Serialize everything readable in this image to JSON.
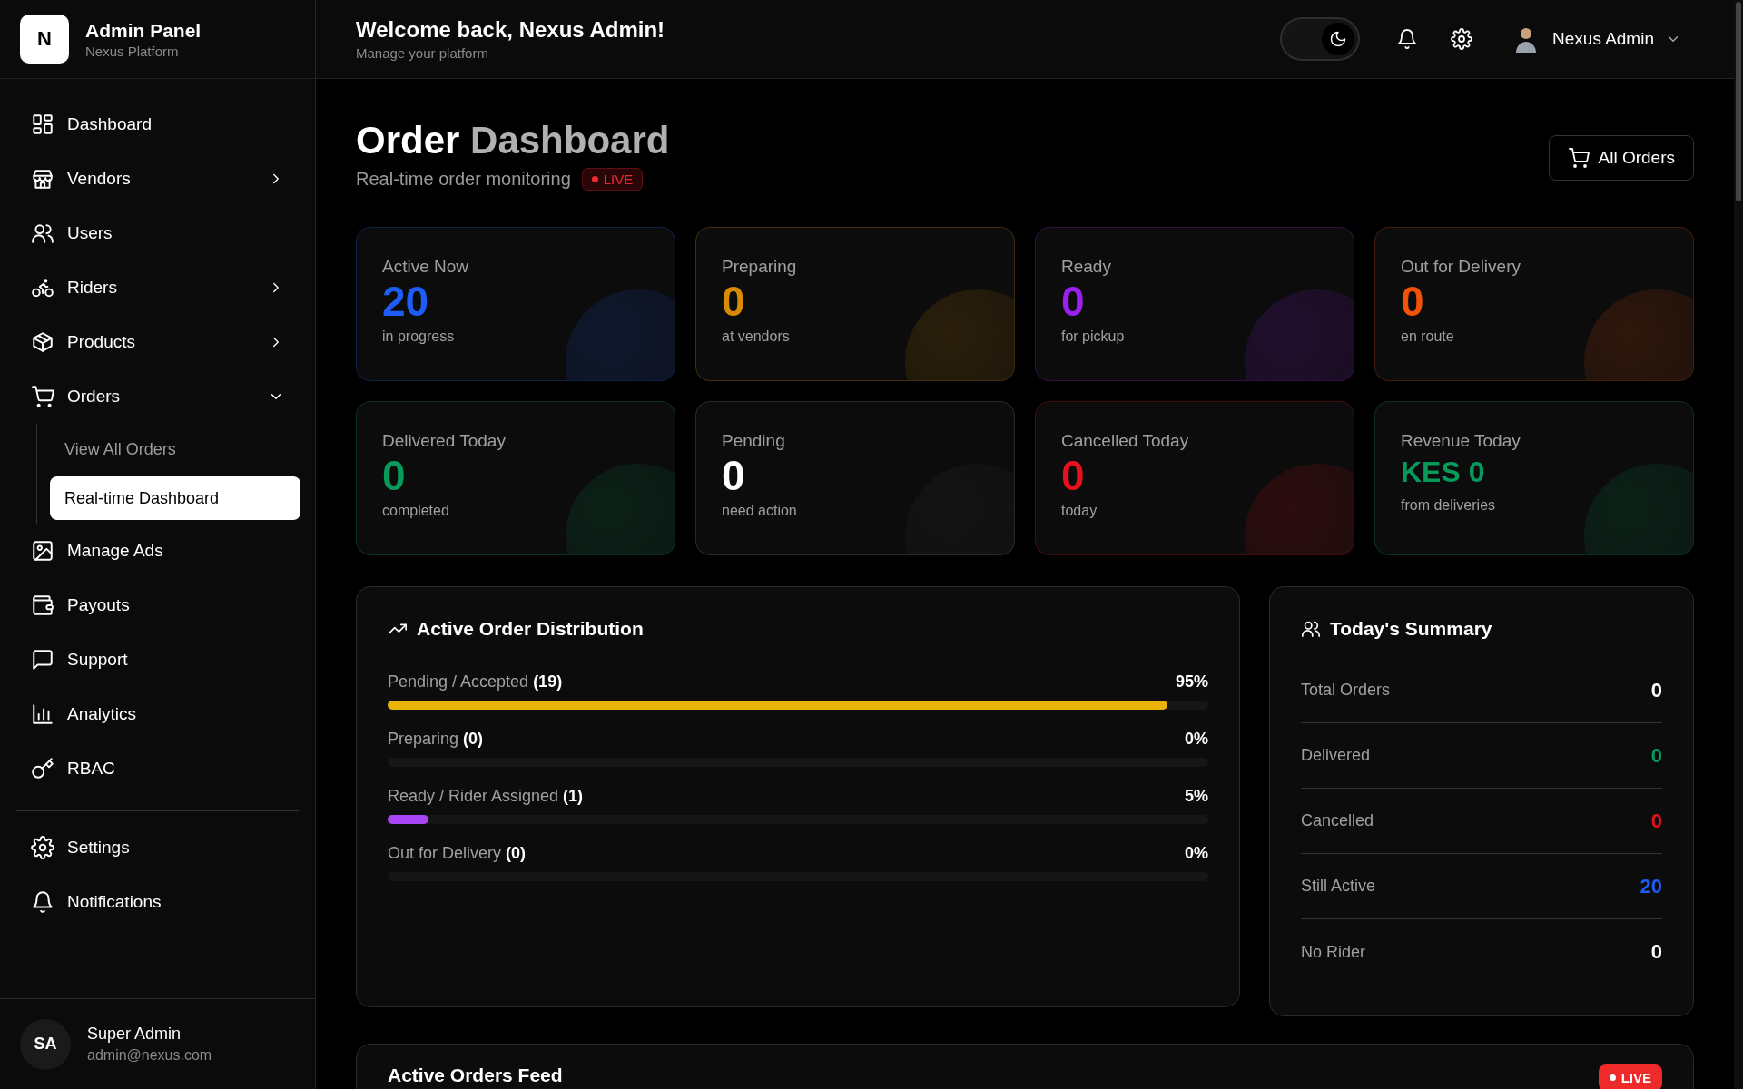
{
  "brand": {
    "logo_letter": "N",
    "title": "Admin Panel",
    "subtitle": "Nexus Platform"
  },
  "sidebar": {
    "items": [
      {
        "label": "Dashboard",
        "selected": false
      },
      {
        "label": "Vendors",
        "selected": false,
        "expanded": false
      },
      {
        "label": "Users",
        "selected": false
      },
      {
        "label": "Riders",
        "selected": false,
        "expanded": false
      },
      {
        "label": "Products",
        "selected": false,
        "expanded": false
      },
      {
        "label": "Orders",
        "selected": false,
        "expanded": true,
        "children": [
          {
            "label": "View All Orders",
            "selected": false
          },
          {
            "label": "Real-time Dashboard",
            "selected": true
          }
        ]
      },
      {
        "label": "Manage Ads",
        "selected": false
      },
      {
        "label": "Payouts",
        "selected": false
      },
      {
        "label": "Support",
        "selected": false
      },
      {
        "label": "Analytics",
        "selected": false
      },
      {
        "label": "RBAC",
        "selected": false
      }
    ],
    "bottom_items": [
      {
        "label": "Settings",
        "selected": false
      },
      {
        "label": "Notifications",
        "selected": false
      }
    ],
    "user": {
      "initials": "SA",
      "name": "Super Admin",
      "email": "admin@nexus.com"
    }
  },
  "topbar": {
    "title": "Welcome back, Nexus Admin!",
    "subtitle": "Manage your platform",
    "dark_mode": true,
    "user_name": "Nexus Admin"
  },
  "header": {
    "title": "Order",
    "title_accent": "Dashboard",
    "subtitle": "Real-time order monitoring",
    "live_badge": "LIVE",
    "button": "All Orders"
  },
  "stats": [
    {
      "label": "Active Now",
      "value": "20",
      "sub": "in progress",
      "color": "#1d5cf5"
    },
    {
      "label": "Preparing",
      "value": "0",
      "sub": "at vendors",
      "color": "#d68a05"
    },
    {
      "label": "Ready",
      "value": "0",
      "sub": "for pickup",
      "color": "#9b1ff0"
    },
    {
      "label": "Out for Delivery",
      "value": "0",
      "sub": "en route",
      "color": "#f25208"
    },
    {
      "label": "Delivered Today",
      "value": "0",
      "sub": "completed",
      "color": "#079a5a"
    },
    {
      "label": "Pending",
      "value": "0",
      "sub": "need action",
      "color": "#ffffff"
    },
    {
      "label": "Cancelled Today",
      "value": "0",
      "sub": "today",
      "color": "#e8101a"
    },
    {
      "label": "Revenue Today",
      "value": "KES 0",
      "sub": "from deliveries",
      "color": "#079a5a"
    }
  ],
  "distribution": {
    "title": "Active Order Distribution",
    "rows": [
      {
        "label": "Pending / Accepted **(19)**",
        "percent": "95%",
        "level": 0.95,
        "color": "#eab308"
      },
      {
        "label": "Preparing **(0)**",
        "percent": "0%"
      },
      {
        "label": "Ready / Rider Assigned **(1)**",
        "percent": "5%",
        "level": 0.05,
        "color": "#a745f5"
      },
      {
        "label": "Out for Delivery **(0)**",
        "percent": "0%"
      }
    ]
  },
  "summary": {
    "title": "Today's Summary",
    "rows": [
      {
        "label": "Total Orders",
        "value": "0",
        "color": "#ffffff"
      },
      {
        "label": "Delivered",
        "value": "0",
        "color": "#079a5a"
      },
      {
        "label": "Cancelled",
        "value": "0",
        "color": "#e8101a"
      },
      {
        "label": "Still Active",
        "value": "20",
        "color": "#1d5cf5"
      },
      {
        "label": "No Rider",
        "value": "0",
        "color": "#ffffff"
      }
    ]
  },
  "feed": {
    "title": "Active Orders Feed",
    "live_badge": "LIVE"
  }
}
